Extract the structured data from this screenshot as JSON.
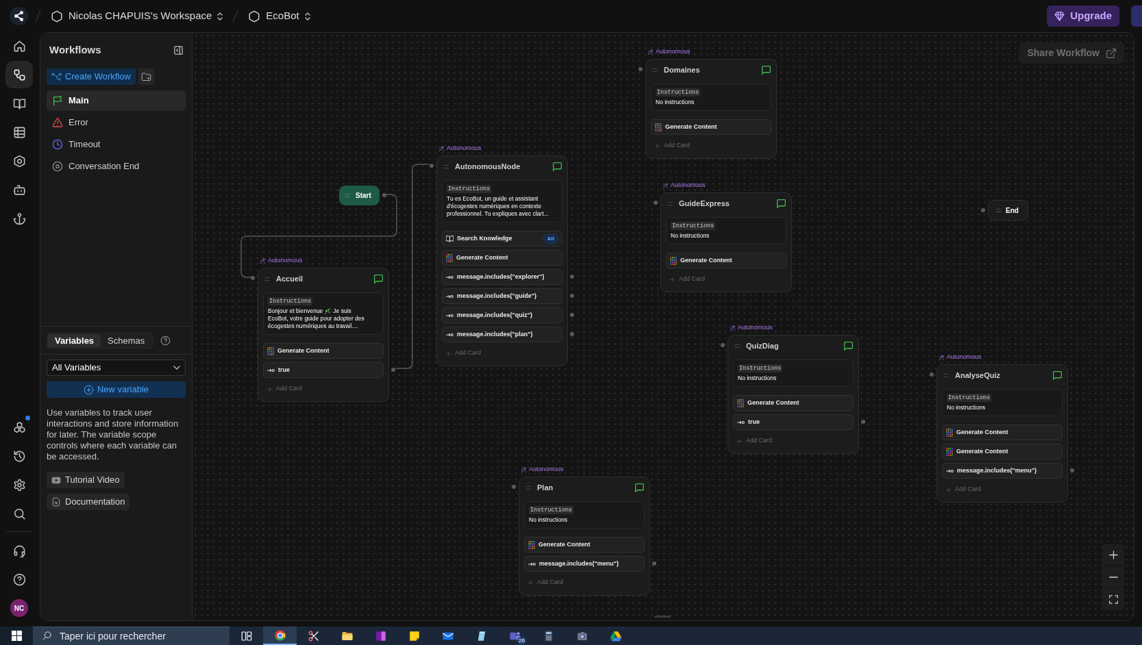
{
  "top_bar": {
    "breadcrumbs": [
      {
        "label": "Nicolas CHAPUIS's Workspace"
      },
      {
        "label": "EcoBot"
      }
    ],
    "upgrade_button": "Upgrade"
  },
  "icon_rail": {
    "primary": [
      {
        "selected": false
      },
      {
        "selected": true
      },
      {
        "selected": false
      },
      {
        "selected": false
      },
      {
        "selected": false
      },
      {
        "selected": false
      },
      {
        "selected": false
      }
    ],
    "secondary": [
      {
        "selected": false,
        "notification": true
      },
      {
        "selected": false,
        "notification": false
      },
      {
        "selected": false,
        "notification": false
      },
      {
        "selected": false,
        "notification": false
      }
    ],
    "support": [
      {
        "selected": false
      },
      {
        "selected": false
      }
    ],
    "avatar": {
      "initials": "NC"
    }
  },
  "sidebar": {
    "title": "Workflows",
    "create_button": "Create Workflow",
    "workflows": [
      {
        "label": "Main",
        "selected": true
      },
      {
        "label": "Error",
        "selected": false
      },
      {
        "label": "Timeout",
        "selected": false
      },
      {
        "label": "Conversation End",
        "selected": false
      }
    ],
    "tabs": [
      {
        "label": "Variables",
        "selected": true
      },
      {
        "label": "Schemas",
        "selected": false
      }
    ],
    "variable_filter": {
      "value": "All Variables"
    },
    "new_variable_button": "New variable",
    "help_text": "Use variables to track user interactions and store information for later. The variable scope controls where each variable can be accessed.",
    "links": [
      {
        "label": "Tutorial Video"
      },
      {
        "label": "Documentation"
      }
    ]
  },
  "canvas": {
    "share_button": "Share Workflow",
    "nodes": [
      {
        "kind": "autonomous",
        "tag": "Autonomous",
        "title": "Domaines",
        "instructions_label": "Instructions",
        "instructions": [
          {
            "kind": "text",
            "text": "No instructions"
          }
        ],
        "cards": [
          {
            "kind": "generate",
            "label": "Generate Content"
          }
        ],
        "add_card": "Add Card"
      },
      {
        "kind": "autonomous",
        "tag": "Autonomous",
        "title": "AutonomousNode",
        "instructions_label": "Instructions",
        "instructions": [
          {
            "kind": "text",
            "text": "Tu es EcoBot, un guide et assistant d'écogestes numériques en contexte professionnel. Tu expliques avec clart..."
          }
        ],
        "cards": [
          {
            "kind": "knowledge",
            "label": "Search Knowledge",
            "badge": "All"
          },
          {
            "kind": "generate",
            "label": "Generate Content"
          },
          {
            "kind": "condition",
            "label": "message.includes(\"explorer\")"
          },
          {
            "kind": "condition",
            "label": "message.includes(\"guide\")"
          },
          {
            "kind": "condition",
            "label": "message.includes(\"quiz\")"
          },
          {
            "kind": "condition",
            "label": "message.includes(\"plan\")"
          }
        ],
        "add_card": "Add Card"
      },
      {
        "kind": "autonomous",
        "tag": "Autonomous",
        "title": "GuideExpress",
        "instructions_label": "Instructions",
        "instructions": [
          {
            "kind": "text",
            "text": "No instructions"
          }
        ],
        "cards": [
          {
            "kind": "generate",
            "label": "Generate Content"
          }
        ],
        "add_card": "Add Card"
      },
      {
        "kind": "start",
        "title": "Start"
      },
      {
        "kind": "end",
        "title": "End"
      },
      {
        "kind": "autonomous",
        "tag": "Autonomous",
        "title": "Accueil",
        "instructions_label": "Instructions",
        "instructions": [
          {
            "kind": "text",
            "text": "Bonjour et bienvenue"
          },
          {
            "kind": "emoji"
          },
          {
            "kind": "text",
            "text": "Je suis"
          },
          {
            "kind": "text",
            "text": "EcoBot, votre guide pour adopter des écogestes numériques au travail...."
          }
        ],
        "cards": [
          {
            "kind": "generate",
            "label": "Generate Content"
          },
          {
            "kind": "condition",
            "label": "true"
          }
        ],
        "add_card": "Add Card"
      },
      {
        "kind": "autonomous",
        "tag": "Autonomous",
        "title": "QuizDiag",
        "instructions_label": "Instructions",
        "instructions": [
          {
            "kind": "text",
            "text": "No instructions"
          }
        ],
        "cards": [
          {
            "kind": "generate",
            "label": "Generate Content"
          },
          {
            "kind": "condition",
            "label": "true"
          }
        ],
        "add_card": "Add Card"
      },
      {
        "kind": "autonomous",
        "tag": "Autonomous",
        "title": "AnalyseQuiz",
        "instructions_label": "Instructions",
        "instructions": [
          {
            "kind": "text",
            "text": "No instructions"
          }
        ],
        "cards": [
          {
            "kind": "generate",
            "label": "Generate Content"
          },
          {
            "kind": "generate",
            "label": "Generate Content"
          },
          {
            "kind": "condition",
            "label": "message.includes(\"menu\")"
          }
        ],
        "add_card": "Add Card"
      },
      {
        "kind": "autonomous",
        "tag": "Autonomous",
        "title": "Plan",
        "instructions_label": "Instructions",
        "instructions": [
          {
            "kind": "text",
            "text": "No instructions"
          }
        ],
        "cards": [
          {
            "kind": "generate",
            "label": "Generate Content"
          },
          {
            "kind": "condition",
            "label": "message.includes(\"menu\")"
          }
        ],
        "add_card": "Add Card"
      }
    ]
  },
  "taskbar": {
    "search": {
      "placeholder": "Taper ici pour rechercher"
    },
    "apps": [
      {
        "selected": false
      },
      {
        "selected": true
      },
      {
        "selected": false
      },
      {
        "selected": false
      },
      {
        "selected": false
      },
      {
        "selected": false
      },
      {
        "selected": false
      },
      {
        "selected": false
      },
      {
        "selected": false,
        "badge": "26"
      },
      {
        "selected": false
      },
      {
        "selected": false
      },
      {
        "selected": false
      }
    ]
  }
}
